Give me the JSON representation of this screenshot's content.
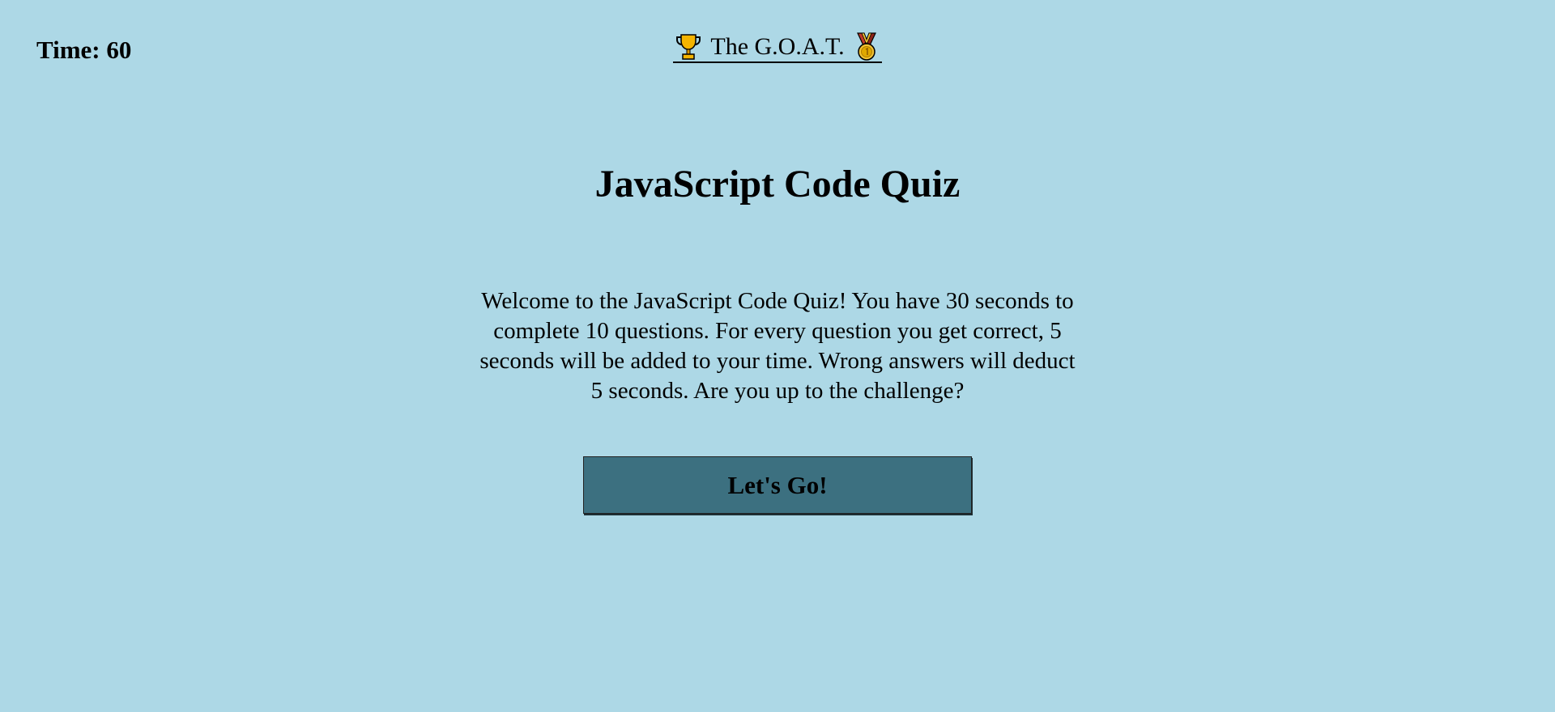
{
  "header": {
    "timer_label": "Time:",
    "timer_value": "60",
    "highscores_link": {
      "left_icon": "trophy-icon",
      "text": "The G.O.A.T.",
      "right_icon": "medal-icon"
    }
  },
  "main": {
    "title": "JavaScript Code Quiz",
    "intro": "Welcome to the JavaScript Code Quiz! You have 30 seconds to complete 10 questions. For every question you get correct, 5 seconds will be added to your time. Wrong answers will deduct 5 seconds. Are you up to the challenge?",
    "start_button_label": "Let's Go!"
  },
  "colors": {
    "background": "#add8e6",
    "button": "#3c7080",
    "trophy": "#f4b400",
    "medal_ribbon": "#c0392b",
    "medal": "#f1c232"
  }
}
